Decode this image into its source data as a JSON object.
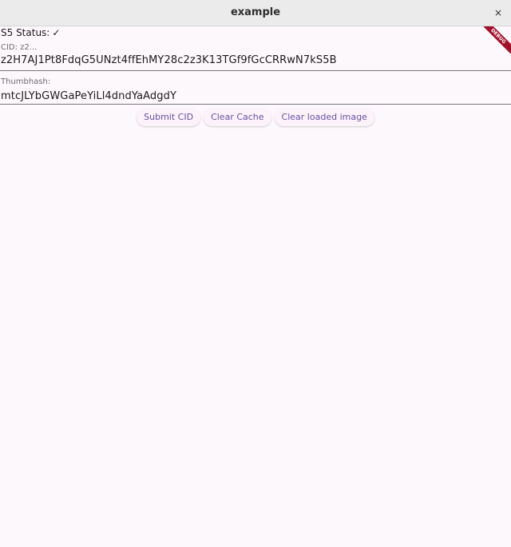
{
  "window": {
    "title": "example",
    "close_symbol": "×"
  },
  "app": {
    "status_label": "S5 Status:",
    "status_symbol": "✓",
    "cid_label": "CID: z2...",
    "cid_value": "z2H7AJ1Pt8FdqG5UNzt4ffEhMY28c2z3K13TGf9fGcCRRwN7kS5B",
    "thumbhash_label": "Thumbhash:",
    "thumbhash_value": "mtcJLYbGWGaPeYiLl4dndYaAdgdY",
    "buttons": {
      "submit": "Submit CID",
      "clear_cache": "Clear Cache",
      "clear_image": "Clear loaded image"
    },
    "debug_banner": "DEBUG"
  }
}
